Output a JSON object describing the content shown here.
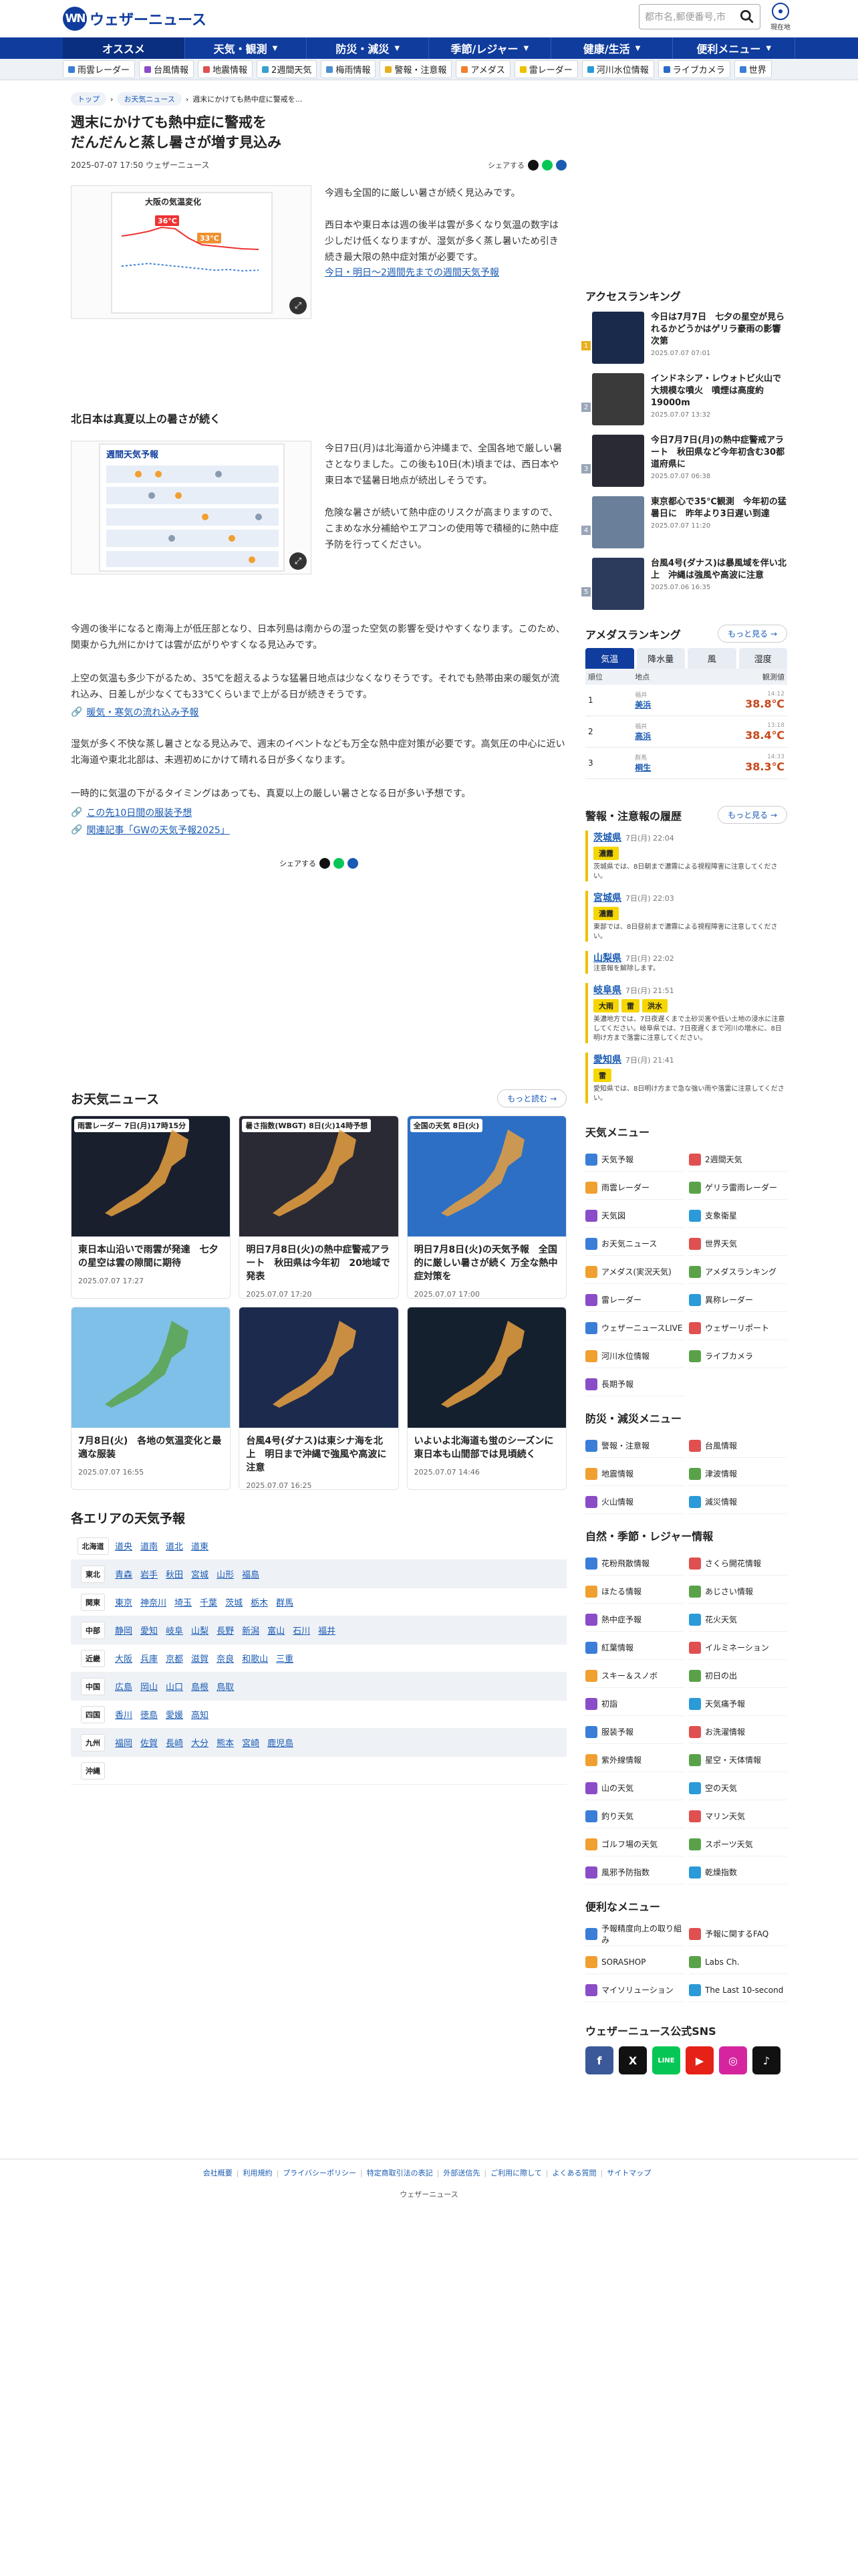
{
  "header": {
    "logo_mark": "WN",
    "logo_text": "ウェザーニュース",
    "search_placeholder": "都市名,郵便番号,市",
    "loc_label": "現在地"
  },
  "nav": [
    {
      "label": "オススメ"
    },
    {
      "label": "天気・観測"
    },
    {
      "label": "防災・減災"
    },
    {
      "label": "季節/レジャー"
    },
    {
      "label": "健康/生活"
    },
    {
      "label": "便利メニュー"
    }
  ],
  "subnav": [
    {
      "label": "雨雲レーダー",
      "color": "#3a7ed8"
    },
    {
      "label": "台風情報",
      "color": "#8a4cc7"
    },
    {
      "label": "地震情報",
      "color": "#e05050"
    },
    {
      "label": "2週間天気",
      "color": "#3aa0d0"
    },
    {
      "label": "梅雨情報",
      "color": "#4c8ed0"
    },
    {
      "label": "警報・注意報",
      "color": "#e8b020"
    },
    {
      "label": "アメダス",
      "color": "#f08030"
    },
    {
      "label": "雷レーダー",
      "color": "#f0c000"
    },
    {
      "label": "河川水位情報",
      "color": "#2a9ad8"
    },
    {
      "label": "ライブカメラ",
      "color": "#2a6ac8"
    },
    {
      "label": "世界",
      "color": "#3a7ed8"
    }
  ],
  "crumbs": [
    "トップ",
    "お天気ニュース",
    "週末にかけても熱中症に警戒を..."
  ],
  "article": {
    "title": "週末にかけても熱中症に警戒を\nだんだんと蒸し暑さが増す見込み",
    "date": "2025-07-07 17:50 ウェザーニュース",
    "share": "シェアする",
    "fig1_title": "大阪の気温変化",
    "fig1_temp1": "36°C",
    "fig1_temp2": "33°C",
    "p1": "今週も全国的に厳しい暑さが続く見込みです。\n\n西日本や東日本は週の後半は雲が多くなり気温の数字は少しだけ低くなりますが、湿気が多く蒸し暑いため引き続き最大限の熱中症対策が必要です。",
    "link1": "今日・明日〜2週間先までの週間天気予報",
    "sec1": "北日本は真夏以上の暑さが続く",
    "fig2_title": "週間天気予報",
    "p2": "今日7日(月)は北海道から沖縄まで、全国各地で厳しい暑さとなりました。この後も10日(木)頃までは、西日本や東日本で猛暑日地点が続出しそうです。\n\n危険な暑さが続いて熱中症のリスクが高まりますので、こまめな水分補給やエアコンの使用等で積極的に熱中症予防を行ってください。",
    "p3": "今週の後半になると南海上が低圧部となり、日本列島は南からの湿った空気の影響を受けやすくなります。このため、関東から九州にかけては雲が広がりやすくなる見込みです。",
    "p4": "上空の気温も多少下がるため、35℃を超えるような猛暑日地点は少なくなりそうです。それでも熱帯由来の暖気が流れ込み、日差しが少なくても33℃くらいまで上がる日が続きそうです。",
    "link2": "暖気・寒気の流れ込み予報",
    "p5": "湿気が多く不快な蒸し暑さとなる見込みで、週末のイベントなども万全な熱中症対策が必要です。高気圧の中心に近い北海道や東北北部は、未週初めにかけて晴れる日が多くなります。",
    "p6": "一時的に気温の下がるタイミングはあっても、真夏以上の厳しい暑さとなる日が多い予想です。",
    "link3": "この先10日間の服装予想",
    "link4": "関連記事「GWの天気予報2025」",
    "share2": "シェアする"
  },
  "news": {
    "heading": "お天気ニュース",
    "more": "もっと読む",
    "items": [
      {
        "tag": "雨雲レーダー 7日(月)17時15分",
        "title": "東日本山沿いで雨雲が発達　七夕の星空は雲の隙間に期待",
        "date": "2025.07.07 17:27",
        "bg": "#1a1f2e"
      },
      {
        "tag": "暑さ指数(WBGT) 8日(火)14時予想",
        "title": "明日7月8日(火)の熱中症警戒アラート　秋田県は今年初　20地域で発表",
        "date": "2025.07.07 17:20",
        "bg": "#2a2a35"
      },
      {
        "tag": "全国の天気 8日(火)",
        "title": "明日7月8日(火)の天気予報　全国的に厳しい暑さが続く 万全な熱中症対策を",
        "date": "2025.07.07 17:00",
        "bg": "#2d6fc4"
      },
      {
        "tag": "",
        "title": "7月8日(火)　各地の気温変化と最適な服装",
        "date": "2025.07.07 16:55",
        "bg": "#7fc0e8"
      },
      {
        "tag": "",
        "title": "台風4号(ダナス)は東シナ海を北上　明日まで沖縄で強風や高波に注意",
        "date": "2025.07.07 16:25",
        "bg": "#1c2a4d"
      },
      {
        "tag": "",
        "title": "いよいよ北海道も蛍のシーズンに 東日本も山間部では見頃続く",
        "date": "2025.07.07 14:46",
        "bg": "#15202e"
      }
    ]
  },
  "areas": {
    "heading": "各エリアの天気予報",
    "rows": [
      {
        "region": "北海道",
        "prefs": [
          "道央",
          "道南",
          "道北",
          "道東"
        ]
      },
      {
        "region": "東北",
        "prefs": [
          "青森",
          "岩手",
          "秋田",
          "宮城",
          "山形",
          "福島"
        ]
      },
      {
        "region": "関東",
        "prefs": [
          "東京",
          "神奈川",
          "埼玉",
          "千葉",
          "茨城",
          "栃木",
          "群馬"
        ]
      },
      {
        "region": "中部",
        "prefs": [
          "静岡",
          "愛知",
          "岐阜",
          "山梨",
          "長野",
          "新潟",
          "富山",
          "石川",
          "福井"
        ]
      },
      {
        "region": "近畿",
        "prefs": [
          "大阪",
          "兵庫",
          "京都",
          "滋賀",
          "奈良",
          "和歌山",
          "三重"
        ]
      },
      {
        "region": "中国",
        "prefs": [
          "広島",
          "岡山",
          "山口",
          "島根",
          "鳥取"
        ]
      },
      {
        "region": "四国",
        "prefs": [
          "香川",
          "徳島",
          "愛媛",
          "高知"
        ]
      },
      {
        "region": "九州",
        "prefs": [
          "福岡",
          "佐賀",
          "長崎",
          "大分",
          "熊本",
          "宮崎",
          "鹿児島"
        ]
      },
      {
        "region": "沖縄",
        "prefs": []
      }
    ]
  },
  "access": {
    "heading": "アクセスランキング",
    "items": [
      {
        "rank": "1",
        "title": "今日は7月7日　七夕の星空が見られるかどうかはゲリラ豪雨の影響次第",
        "date": "2025.07.07 07:01",
        "bg": "#1a2a4a"
      },
      {
        "rank": "2",
        "title": "インドネシア・レウォトビ火山で大規模な噴火　噴煙は高度約19000m",
        "date": "2025.07.07 13:32",
        "bg": "#3a3a3a"
      },
      {
        "rank": "3",
        "title": "今日7月7日(月)の熱中症警戒アラート　秋田県など今年初含む30都道府県に",
        "date": "2025.07.07 06:38",
        "bg": "#2a2a35"
      },
      {
        "rank": "4",
        "title": "東京都心で35℃観測　今年初の猛暑日に　昨年より3日遅い到達",
        "date": "2025.07.07 11:20",
        "bg": "#6a7f99"
      },
      {
        "rank": "5",
        "title": "台風4号(ダナス)は暴風域を伴い北上　沖縄は強風や高波に注意",
        "date": "2025.07.06 16:35",
        "bg": "#2c3a5c"
      }
    ]
  },
  "amedas": {
    "heading": "アメダスランキング",
    "more": "もっと見る",
    "tabs": [
      "気温",
      "降水量",
      "風",
      "湿度"
    ],
    "cols": [
      "順位",
      "地点",
      "観測値"
    ],
    "rows": [
      {
        "rank": "1",
        "pref": "福井",
        "name": "美浜",
        "obs": "38.8℃",
        "time": "14:12"
      },
      {
        "rank": "2",
        "pref": "福井",
        "name": "高浜",
        "obs": "38.4℃",
        "time": "13:18"
      },
      {
        "rank": "3",
        "pref": "群馬",
        "name": "桐生",
        "obs": "38.3℃",
        "time": "14:33"
      }
    ]
  },
  "warnings": {
    "heading": "警報・注意報の履歴",
    "more": "もっと見る",
    "items": [
      {
        "pref": "茨城県",
        "time": "7日(月) 22:04",
        "badges": [
          {
            "t": "濃霧",
            "c": "#f5d600"
          }
        ],
        "text": "茨城県では、8日朝まで濃霧による視程障害に注意してください。"
      },
      {
        "pref": "宮城県",
        "time": "7日(月) 22:03",
        "badges": [
          {
            "t": "濃霧",
            "c": "#f5d600"
          }
        ],
        "text": "東部では、8日昼前まで濃霧による視程障害に注意してください。"
      },
      {
        "pref": "山梨県",
        "time": "7日(月) 22:02",
        "badges": [],
        "text": "注意報を解除します。"
      },
      {
        "pref": "岐阜県",
        "time": "7日(月) 21:51",
        "badges": [
          {
            "t": "大雨",
            "c": "#f5d600"
          },
          {
            "t": "雷",
            "c": "#f5d600"
          },
          {
            "t": "洪水",
            "c": "#f5d600"
          }
        ],
        "text": "美濃地方では、7日夜遅くまで土砂災害や低い土地の浸水に注意してください。岐阜県では、7日夜遅くまで河川の増水に、8日明け方まで落雷に注意してください。"
      },
      {
        "pref": "愛知県",
        "time": "7日(月) 21:41",
        "badges": [
          {
            "t": "雷",
            "c": "#f5d600"
          }
        ],
        "text": "愛知県では、8日明け方まで急な強い雨や落雷に注意してください。"
      }
    ]
  },
  "menus": [
    {
      "heading": "天気メニュー",
      "items": [
        "天気予報",
        "2週間天気",
        "雨雲レーダー",
        "ゲリラ雷雨レーダー",
        "天気図",
        "支象衛星",
        "お天気ニュース",
        "世界天気",
        "アメダス(実況天気)",
        "アメダスランキング",
        "雷レーダー",
        "異称レーダー",
        "ウェザーニュースLIVE",
        "ウェザーリポート",
        "河川水位情報",
        "ライブカメラ",
        "長期予報"
      ]
    },
    {
      "heading": "防災・減災メニュー",
      "items": [
        "警報・注意報",
        "台風情報",
        "地震情報",
        "津波情報",
        "火山情報",
        "減災情報"
      ]
    },
    {
      "heading": "自然・季節・レジャー情報",
      "items": [
        "花粉飛散情報",
        "さくら開花情報",
        "ほたる情報",
        "あじさい情報",
        "熱中症予報",
        "花火天気",
        "紅葉情報",
        "イルミネーション",
        "スキー＆スノボ",
        "初日の出",
        "初詣",
        "天気痛予報",
        "服装予報",
        "お洗濯情報",
        "紫外線情報",
        "星空・天体情報",
        "山の天気",
        "空の天気",
        "釣り天気",
        "マリン天気",
        "ゴルフ場の天気",
        "スポーツ天気",
        "風邪予防指数",
        "乾燥指数"
      ]
    },
    {
      "heading": "便利なメニュー",
      "items": [
        "予報精度向上の取り組み",
        "予報に関するFAQ",
        "SORASHOP",
        "Labs Ch.",
        "マイソリューション",
        "The Last 10-second"
      ]
    }
  ],
  "sns": {
    "heading": "ウェザーニュース公式SNS",
    "items": [
      {
        "l": "f",
        "c": "#3b5998"
      },
      {
        "l": "X",
        "c": "#111"
      },
      {
        "l": "LINE",
        "c": "#06c755"
      },
      {
        "l": "▶",
        "c": "#e62117"
      },
      {
        "l": "◎",
        "c": "#d6249f"
      },
      {
        "l": "♪",
        "c": "#111"
      }
    ]
  },
  "footer": {
    "links": [
      "会社概要",
      "利用規約",
      "プライバシーポリシー",
      "特定商取引法の表記",
      "外部送信先",
      "ご利用に際して",
      "よくある質問",
      "サイトマップ"
    ],
    "copy": "ウェザーニュース"
  }
}
